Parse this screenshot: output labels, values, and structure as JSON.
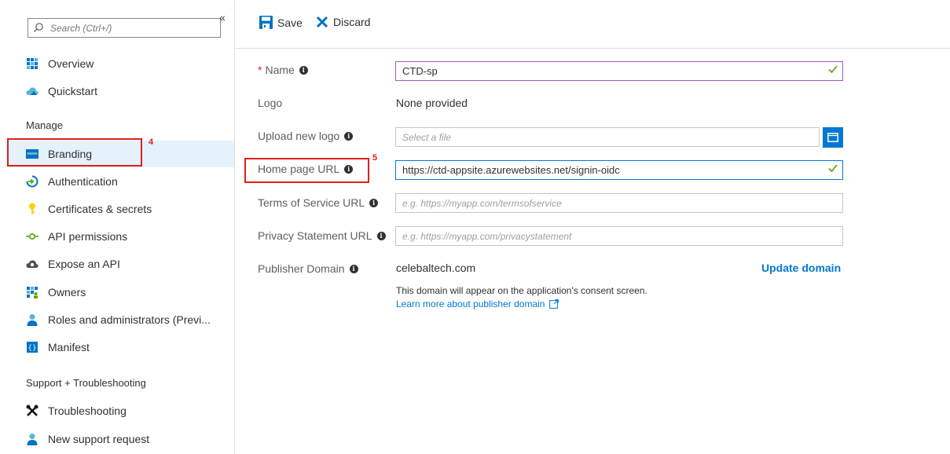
{
  "sidebar": {
    "search_placeholder": "Search (Ctrl+/)",
    "collapse_glyph": "«",
    "top_items": [
      {
        "label": "Overview",
        "icon": "overview-grid-icon"
      },
      {
        "label": "Quickstart",
        "icon": "cloud-icon"
      }
    ],
    "manage_header": "Manage",
    "manage_items": [
      {
        "label": "Branding",
        "icon": "branding-card-icon",
        "active": true
      },
      {
        "label": "Authentication",
        "icon": "authentication-arrow-icon"
      },
      {
        "label": "Certificates & secrets",
        "icon": "key-icon"
      },
      {
        "label": "API permissions",
        "icon": "api-arrow-icon"
      },
      {
        "label": "Expose an API",
        "icon": "cloud-gear-icon"
      },
      {
        "label": "Owners",
        "icon": "owners-grid-icon"
      },
      {
        "label": "Roles and administrators (Previ...",
        "icon": "person-icon"
      },
      {
        "label": "Manifest",
        "icon": "manifest-braces-icon"
      }
    ],
    "support_header": "Support + Troubleshooting",
    "support_items": [
      {
        "label": "Troubleshooting",
        "icon": "wrench-icon"
      },
      {
        "label": "New support request",
        "icon": "person-support-icon"
      }
    ]
  },
  "annotations": {
    "marker_4": "4",
    "marker_5": "5"
  },
  "toolbar": {
    "save_label": "Save",
    "discard_label": "Discard"
  },
  "form": {
    "name": {
      "label": "Name",
      "required_mark": "*",
      "value": "CTD-sp"
    },
    "logo": {
      "label": "Logo",
      "value": "None provided"
    },
    "upload_logo": {
      "label": "Upload new logo",
      "placeholder": "Select a file"
    },
    "home_page_url": {
      "label": "Home page URL",
      "value": "https://ctd-appsite.azurewebsites.net/signin-oidc"
    },
    "terms_url": {
      "label": "Terms of Service URL",
      "placeholder": "e.g. https://myapp.com/termsofservice"
    },
    "privacy_url": {
      "label": "Privacy Statement URL",
      "placeholder": "e.g. https://myapp.com/privacystatement"
    },
    "publisher_domain": {
      "label": "Publisher Domain",
      "value": "celebaltech.com",
      "update_link": "Update domain",
      "note": "This domain will appear on the application's consent screen.",
      "learn_more": "Learn more about publisher domain"
    }
  },
  "colors": {
    "accent": "#0078d4",
    "valid_check": "#57a300",
    "annotation_red": "#e0201b",
    "active_nav_bg": "#e5f1fb"
  }
}
